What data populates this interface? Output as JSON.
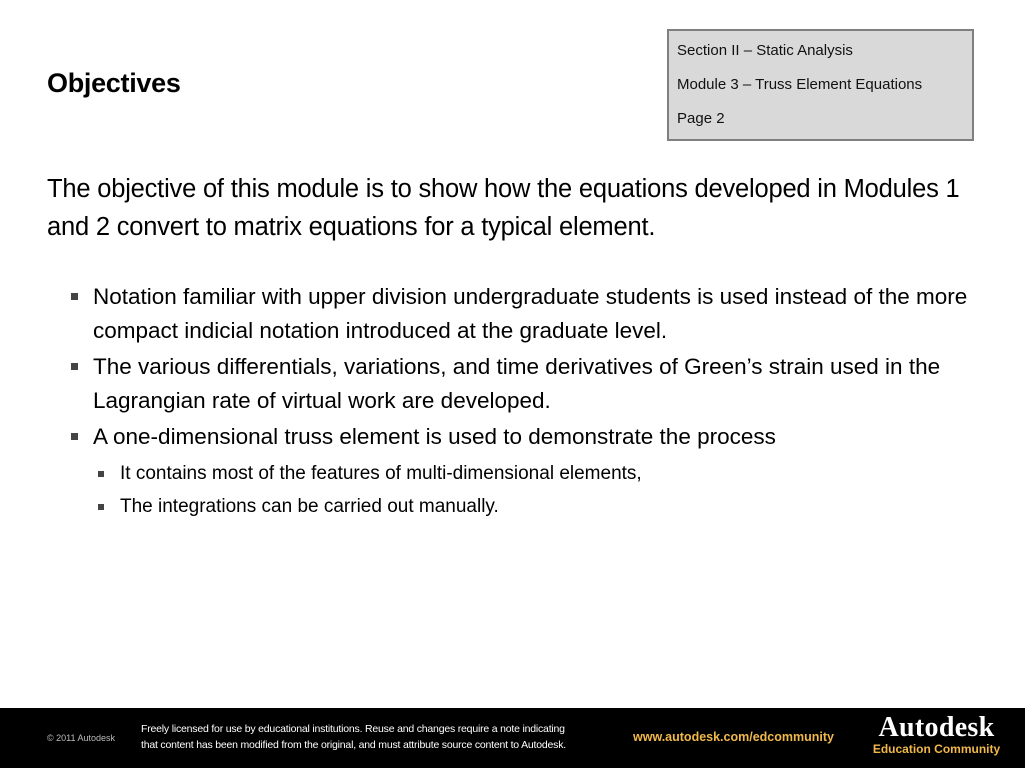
{
  "slide": {
    "title": "Objectives",
    "info_box": {
      "section": "Section II – Static Analysis",
      "module": "Module 3 – Truss Element Equations",
      "page": "Page 2"
    },
    "intro": "The objective of this module is to show how the equations developed in Modules 1 and 2 convert to matrix equations for a typical element.",
    "bullets": [
      {
        "text": "Notation familiar with upper division undergraduate students is used instead of the more compact indicial notation introduced at the graduate level."
      },
      {
        "text": "The various differentials, variations, and time derivatives of Green’s strain used in the Lagrangian rate of virtual work are developed."
      },
      {
        "text": "A one-dimensional truss element is used to demonstrate the process",
        "sub_bullets": [
          "It contains most of the features of multi-dimensional elements,",
          "The integrations can be carried out manually."
        ]
      }
    ]
  },
  "footer": {
    "copyright": "© 2011 Autodesk",
    "license_line1": "Freely licensed for use by educational institutions. Reuse and changes require a note indicating",
    "license_line2": "that content has been modified from the original, and must attribute source content to Autodesk.",
    "url": "www.autodesk.com/edcommunity",
    "brand_name": "Autodesk",
    "brand_sub": "Education Community",
    "accent_color": "#f0b84a",
    "background_color": "#000000"
  }
}
